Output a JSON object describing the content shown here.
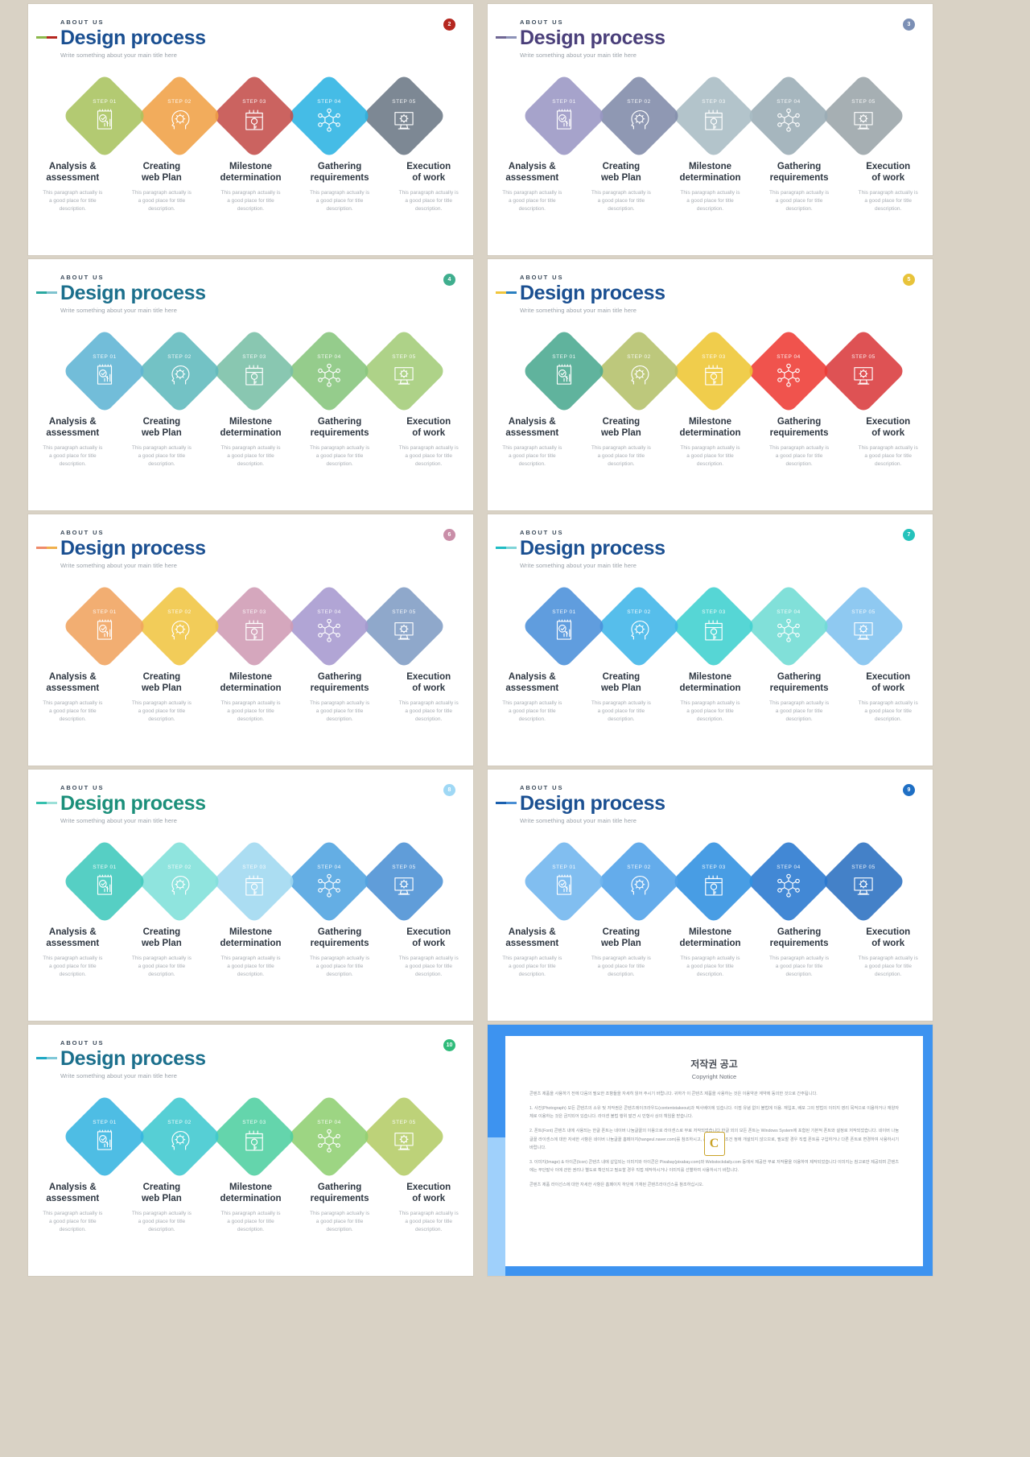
{
  "common": {
    "eyebrow": "ABOUT US",
    "title": "Design process",
    "subtitle": "Write something about your main title here",
    "step_labels": [
      "STEP 01",
      "STEP 02",
      "STEP 03",
      "STEP 04",
      "STEP 05"
    ],
    "captions": [
      "Analysis &\nassessment",
      "Creating\nweb Plan",
      "Milestone\ndetermination",
      "Gathering\nrequirements",
      "Execution\nof work"
    ],
    "descriptions": [
      "This paragraph  actually is\na good place for title\ndescription.",
      "This paragraph  actually is\na good place for title\ndescription.",
      "This paragraph  actually is\na good place for title\ndescription.",
      "This paragraph  actually is\na good place for title\ndescription.",
      "This paragraph  actually is\na good place for title\ndescription."
    ],
    "icons": [
      "document-search-chart-icon",
      "head-gear-icon",
      "calendar-key-icon",
      "network-nodes-icon",
      "monitor-gear-icon"
    ],
    "background": "#d9d2c5"
  },
  "slides": [
    {
      "number": "2",
      "badge_color": "#b5271f",
      "title_color": "#1a4f91",
      "dash": [
        "#8cb84b",
        "#b5271f"
      ],
      "colors": [
        "#a8c35f",
        "#f0a045",
        "#c44d4a",
        "#2bb3e3",
        "#6b7785"
      ]
    },
    {
      "number": "3",
      "badge_color": "#7b8fb5",
      "title_color": "#4a3f7a",
      "dash": [
        "#6f6694",
        "#8d93b8"
      ],
      "colors": [
        "#9a96c4",
        "#7f8aa8",
        "#a8bcc4",
        "#9aacb5",
        "#9aa4a8"
      ]
    },
    {
      "number": "4",
      "badge_color": "#3fae8e",
      "title_color": "#1b6f8c",
      "dash": [
        "#2aa8a0",
        "#7fc3cf"
      ],
      "colors": [
        "#5fb4d4",
        "#60b9bd",
        "#79bfa6",
        "#86c57c",
        "#a3cc78"
      ]
    },
    {
      "number": "5",
      "badge_color": "#e8c33a",
      "title_color": "#1a4f91",
      "dash": [
        "#f0c53c",
        "#2a7fc0"
      ],
      "colors": [
        "#4aa98f",
        "#b4c06a",
        "#eec633",
        "#ee3b34",
        "#d93a3c"
      ]
    },
    {
      "number": "6",
      "badge_color": "#c98ea8",
      "title_color": "#1a4f91",
      "dash": [
        "#ef8b6a",
        "#f0b04d"
      ],
      "colors": [
        "#f0a35f",
        "#f0c542",
        "#cf9bb4",
        "#a698cf",
        "#7f9cc4"
      ]
    },
    {
      "number": "7",
      "badge_color": "#25c2bb",
      "title_color": "#1a4f91",
      "dash": [
        "#1fbcc4",
        "#7fd4d8"
      ],
      "colors": [
        "#4a90d9",
        "#3fb5e8",
        "#3fd0cf",
        "#6fdcd4",
        "#7fc2ef"
      ]
    },
    {
      "number": "8",
      "badge_color": "#9fd8f5",
      "title_color": "#1b8f7a",
      "dash": [
        "#35c0ad",
        "#9ce0d8"
      ],
      "colors": [
        "#3fc8bc",
        "#7fe0da",
        "#9fd8f0",
        "#4fa3e0",
        "#4a8fd4"
      ]
    },
    {
      "number": "9",
      "badge_color": "#1f6fc4",
      "title_color": "#1a4f91",
      "dash": [
        "#1a5fae",
        "#4a8fd4"
      ],
      "colors": [
        "#6fb5ee",
        "#4fa0e8",
        "#2f8fe0",
        "#2878cf",
        "#2a6fc0"
      ]
    },
    {
      "number": "10",
      "badge_color": "#2fbb7a",
      "title_color": "#1b6f8c",
      "dash": [
        "#1fa8c4",
        "#7fc8d8"
      ],
      "colors": [
        "#35b4e0",
        "#3fc8cf",
        "#4fcfa0",
        "#8fcf72",
        "#b4cc66"
      ]
    }
  ],
  "copyright": {
    "heading_ko": "저작권 공고",
    "heading_en": "Copyright Notice",
    "mark": "C",
    "paragraphs": [
      "콘텐츠 제품을 사용하기 전에 다음의 필요한 조항들을 자세히 읽어 주시기 바랍니다. 귀하가 이 콘텐츠 제품을 사용하는 것은 이용약관 계약에 동의한 것으로 간주됩니다.",
      "1. 사진(Photograph) 모든 콘텐츠의 소유 및 저작권은 콘텐츠레이크라우드(contentstakeout)과 픽사베이에 있습니다. 이점 유념 없이 불법에 이용. 재입포, 배포 그외 방법의 이미지 영리 목적으로 이용하거나 재양자체로 이용하는 것은 금지되어 있습니다. 라이센 불법 행위 발견 시 민형사 상의 책임을 받습니다.",
      "2. 폰트(Font) 콘텐츠 내에 사용되는 한글 폰트는 네이버 나눔글꼴의 이용으로 라이센스로 무료 저작되었습니다 한글 외의 모든 폰트는 Windows System에 포함된 기본적 폰트와 설정로 저작되었습니다. 네이버 나눔글꼴 라이센스에 대한 자세한 사항은 네이버 나눔글꼴 홈페이지(hangeul.naver.com)를 참조하시고, 폰트의 권리 조건 정에 개설되지 않으므로, 필요할 경우 직접 폰트를 구입하거나 다른 폰트로 변경하여 사용하시기 바랍니다.",
      "3. 이미지(Image) & 아이콘(Icon) 콘텐츠 내에 삽입되는 이미지와 아이콘은 Pixabay(pixabay.com)와 Webstockdaily.com 등에서 제공한 무료 저작물을 이용하여 제작되었습니다 이미지는 참고로만 제공되며 콘텐츠에는 무단발사 이에 관한 권리나 별도로 확인되고 필요할 경우 직접 제작하시거나 이미지를 선별하여 사용하시기 바랍니다.",
      "콘텐츠 제품 라이선스에 대한 자세한 사항은 홈페이지 하단에 기재된 콘텐츠라이선스를 참조하십시오."
    ]
  }
}
